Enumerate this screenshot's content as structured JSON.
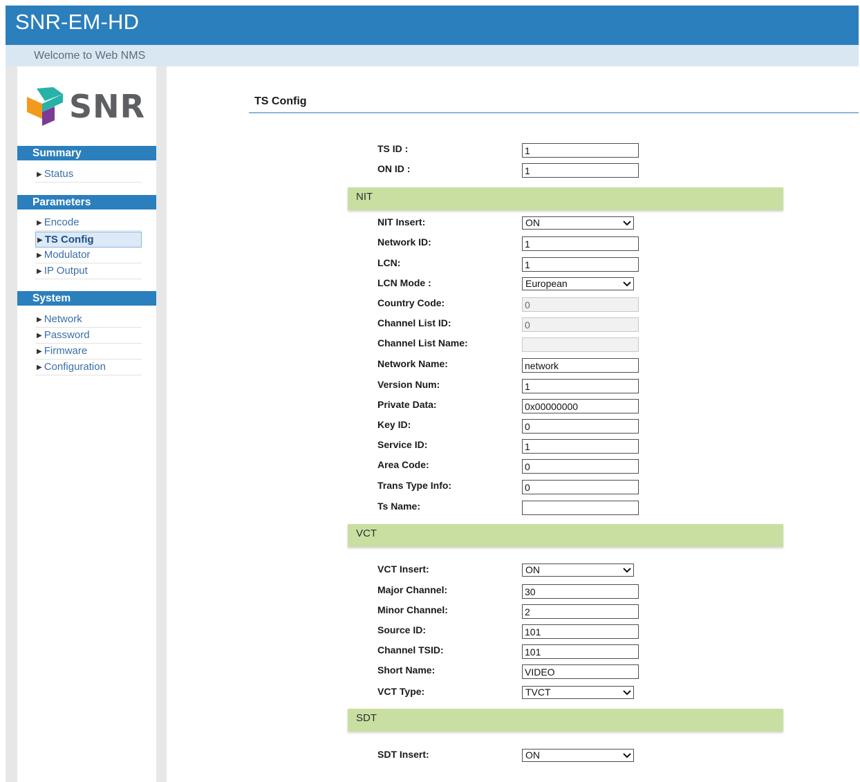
{
  "header": {
    "title": "SNR-EM-HD",
    "welcome": "Welcome to Web NMS"
  },
  "logo": {
    "text": "SNR",
    "colors": [
      "#f39a1e",
      "#27b3a7",
      "#7a3b94"
    ]
  },
  "sidebar": {
    "sections": [
      {
        "title": "Summary",
        "items": [
          {
            "label": "Status"
          }
        ]
      },
      {
        "title": "Parameters",
        "items": [
          {
            "label": "Encode"
          },
          {
            "label": "TS Config",
            "active": true
          },
          {
            "label": "Modulator"
          },
          {
            "label": "IP Output"
          }
        ]
      },
      {
        "title": "System",
        "items": [
          {
            "label": "Network"
          },
          {
            "label": "Password"
          },
          {
            "label": "Firmware"
          },
          {
            "label": "Configuration"
          }
        ]
      }
    ]
  },
  "content": {
    "title": "TS Config",
    "general": {
      "ts_id": {
        "label": "TS ID :",
        "value": "1"
      },
      "on_id": {
        "label": "ON ID :",
        "value": "1"
      }
    },
    "nit": {
      "title": "NIT",
      "nit_insert": {
        "label": "NIT Insert:",
        "value": "ON"
      },
      "network_id": {
        "label": "Network ID:",
        "value": "1"
      },
      "lcn": {
        "label": "LCN:",
        "value": "1"
      },
      "lcn_mode": {
        "label": "LCN Mode :",
        "value": "European"
      },
      "country_code": {
        "label": "Country Code:",
        "value": "0"
      },
      "channel_list_id": {
        "label": "Channel List ID:",
        "value": "0"
      },
      "channel_list_name": {
        "label": "Channel List Name:",
        "value": ""
      },
      "network_name": {
        "label": "Network Name:",
        "value": "network"
      },
      "version_num": {
        "label": "Version Num:",
        "value": "1"
      },
      "private_data": {
        "label": "Private Data:",
        "value": "0x00000000"
      },
      "key_id": {
        "label": "Key ID:",
        "value": "0"
      },
      "service_id": {
        "label": "Service ID:",
        "value": "1"
      },
      "area_code": {
        "label": "Area Code:",
        "value": "0"
      },
      "trans_type_info": {
        "label": "Trans Type Info:",
        "value": "0"
      },
      "ts_name": {
        "label": "Ts Name:",
        "value": ""
      }
    },
    "vct": {
      "title": "VCT",
      "vct_insert": {
        "label": "VCT Insert:",
        "value": "ON"
      },
      "major_channel": {
        "label": "Major Channel:",
        "value": "30"
      },
      "minor_channel": {
        "label": "Minor Channel:",
        "value": "2"
      },
      "source_id": {
        "label": "Source ID:",
        "value": "101"
      },
      "channel_tsid": {
        "label": "Channel TSID:",
        "value": "101"
      },
      "short_name": {
        "label": "Short Name:",
        "value": "VIDEO"
      },
      "vct_type": {
        "label": "VCT Type:",
        "value": "TVCT"
      }
    },
    "sdt": {
      "title": "SDT",
      "sdt_insert": {
        "label": "SDT Insert:",
        "value": "ON"
      }
    }
  },
  "colors": {
    "header_blue": "#2b7fbd",
    "welcome_bg": "#d9e7f2",
    "band_green": "#c9dfa2",
    "link_blue": "#3a6fa8"
  }
}
